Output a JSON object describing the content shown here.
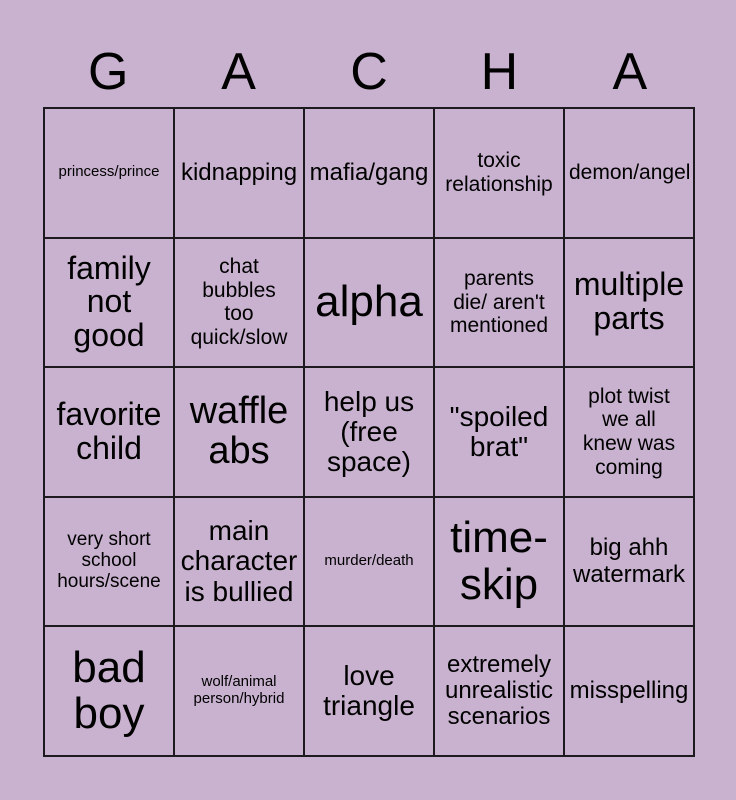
{
  "card": {
    "header_letters": [
      "G",
      "A",
      "C",
      "H",
      "A"
    ],
    "background_color": "#c9b2cf",
    "border_color": "#1c1a1e",
    "text_color": "#000000",
    "grid_size": "5x5"
  },
  "cells": [
    {
      "text": "princess/prince",
      "size": "fs-xs"
    },
    {
      "text": "kidnapping",
      "size": "fs-m"
    },
    {
      "text": "mafia/gang",
      "size": "fs-m"
    },
    {
      "text": "toxic\nrelationship",
      "size": "fs-sm"
    },
    {
      "text": "demon/angel",
      "size": "fs-sm"
    },
    {
      "text": "family\nnot\ngood",
      "size": "fs-l"
    },
    {
      "text": "chat\nbubbles\ntoo\nquick/slow",
      "size": "fs-sm"
    },
    {
      "text": "alpha",
      "size": "fs-xxl"
    },
    {
      "text": "parents\ndie/ aren't\nmentioned",
      "size": "fs-sm"
    },
    {
      "text": "multiple\nparts",
      "size": "fs-l"
    },
    {
      "text": "favorite\nchild",
      "size": "fs-l"
    },
    {
      "text": "waffle\nabs",
      "size": "fs-xl"
    },
    {
      "text": "help us\n(free\nspace)",
      "size": "fs-ml"
    },
    {
      "text": "\"spoiled\nbrat\"",
      "size": "fs-ml"
    },
    {
      "text": "plot twist\nwe all\nknew was\ncoming",
      "size": "fs-sm"
    },
    {
      "text": "very short\nschool\nhours/scene",
      "size": "fs-s"
    },
    {
      "text": "main\ncharacter\nis bullied",
      "size": "fs-ml"
    },
    {
      "text": "murder/death",
      "size": "fs-xs"
    },
    {
      "text": "time-\nskip",
      "size": "fs-xxl"
    },
    {
      "text": "big ahh\nwatermark",
      "size": "fs-m"
    },
    {
      "text": "bad\nboy",
      "size": "fs-xxl"
    },
    {
      "text": "wolf/animal\nperson/hybrid",
      "size": "fs-xs"
    },
    {
      "text": "love\ntriangle",
      "size": "fs-ml"
    },
    {
      "text": "extremely\nunrealistic\nscenarios",
      "size": "fs-m"
    },
    {
      "text": "misspelling",
      "size": "fs-m"
    }
  ]
}
